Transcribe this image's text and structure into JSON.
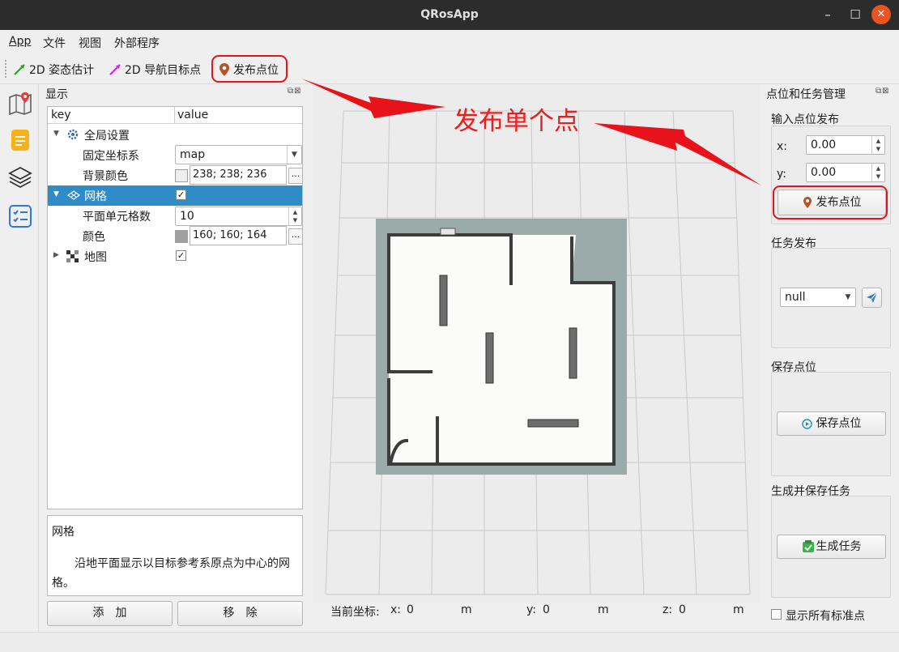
{
  "window": {
    "title": "QRosApp"
  },
  "menubar": {
    "items": [
      "App",
      "文件",
      "视图",
      "外部程序"
    ]
  },
  "toolbar": {
    "pose_estimate": "2D 姿态估计",
    "nav_goal": "2D 导航目标点",
    "publish_point": "发布点位"
  },
  "display_panel": {
    "title": "显示",
    "columns": {
      "key": "key",
      "value": "value"
    },
    "tree": {
      "global": {
        "label": "全局设置"
      },
      "fixed_frame": {
        "label": "固定坐标系",
        "value": "map"
      },
      "bg_color": {
        "label": "背景颜色",
        "value": "238; 238; 236",
        "swatch": "#eeeeec"
      },
      "grid": {
        "label": "网格",
        "checked": "✓"
      },
      "cell_count": {
        "label": "平面单元格数",
        "value": "10"
      },
      "grid_color": {
        "label": "颜色",
        "value": "160; 160; 164",
        "swatch": "#a0a0a4"
      },
      "map": {
        "label": "地图",
        "checked": "✓"
      }
    },
    "description": {
      "title": "网格",
      "text": "沿地平面显示以目标参考系原点为中心的网格。"
    },
    "add_button": "添　加",
    "remove_button": "移　除"
  },
  "view": {
    "coords": {
      "label": "当前坐标:",
      "x_label": "x:",
      "x": "0",
      "y_label": "y:",
      "y": "0",
      "z_label": "z:",
      "z": "0",
      "unit": "m"
    }
  },
  "right_panel": {
    "title": "点位和任务管理",
    "input_group": {
      "title": "输入点位发布",
      "x_label": "x:",
      "x_value": "0.00",
      "y_label": "y:",
      "y_value": "0.00",
      "publish_button": "发布点位"
    },
    "task_group": {
      "title": "任务发布",
      "selected": "null"
    },
    "save_group": {
      "title": "保存点位",
      "button": "保存点位"
    },
    "gen_group": {
      "title": "生成并保存任务",
      "button": "生成任务"
    },
    "show_all": "显示所有标准点"
  },
  "annotation": {
    "text": "发布单个点",
    "color": "#ee1c1c"
  },
  "colors": {
    "selection": "#308cc6",
    "accent": "#e95420"
  }
}
